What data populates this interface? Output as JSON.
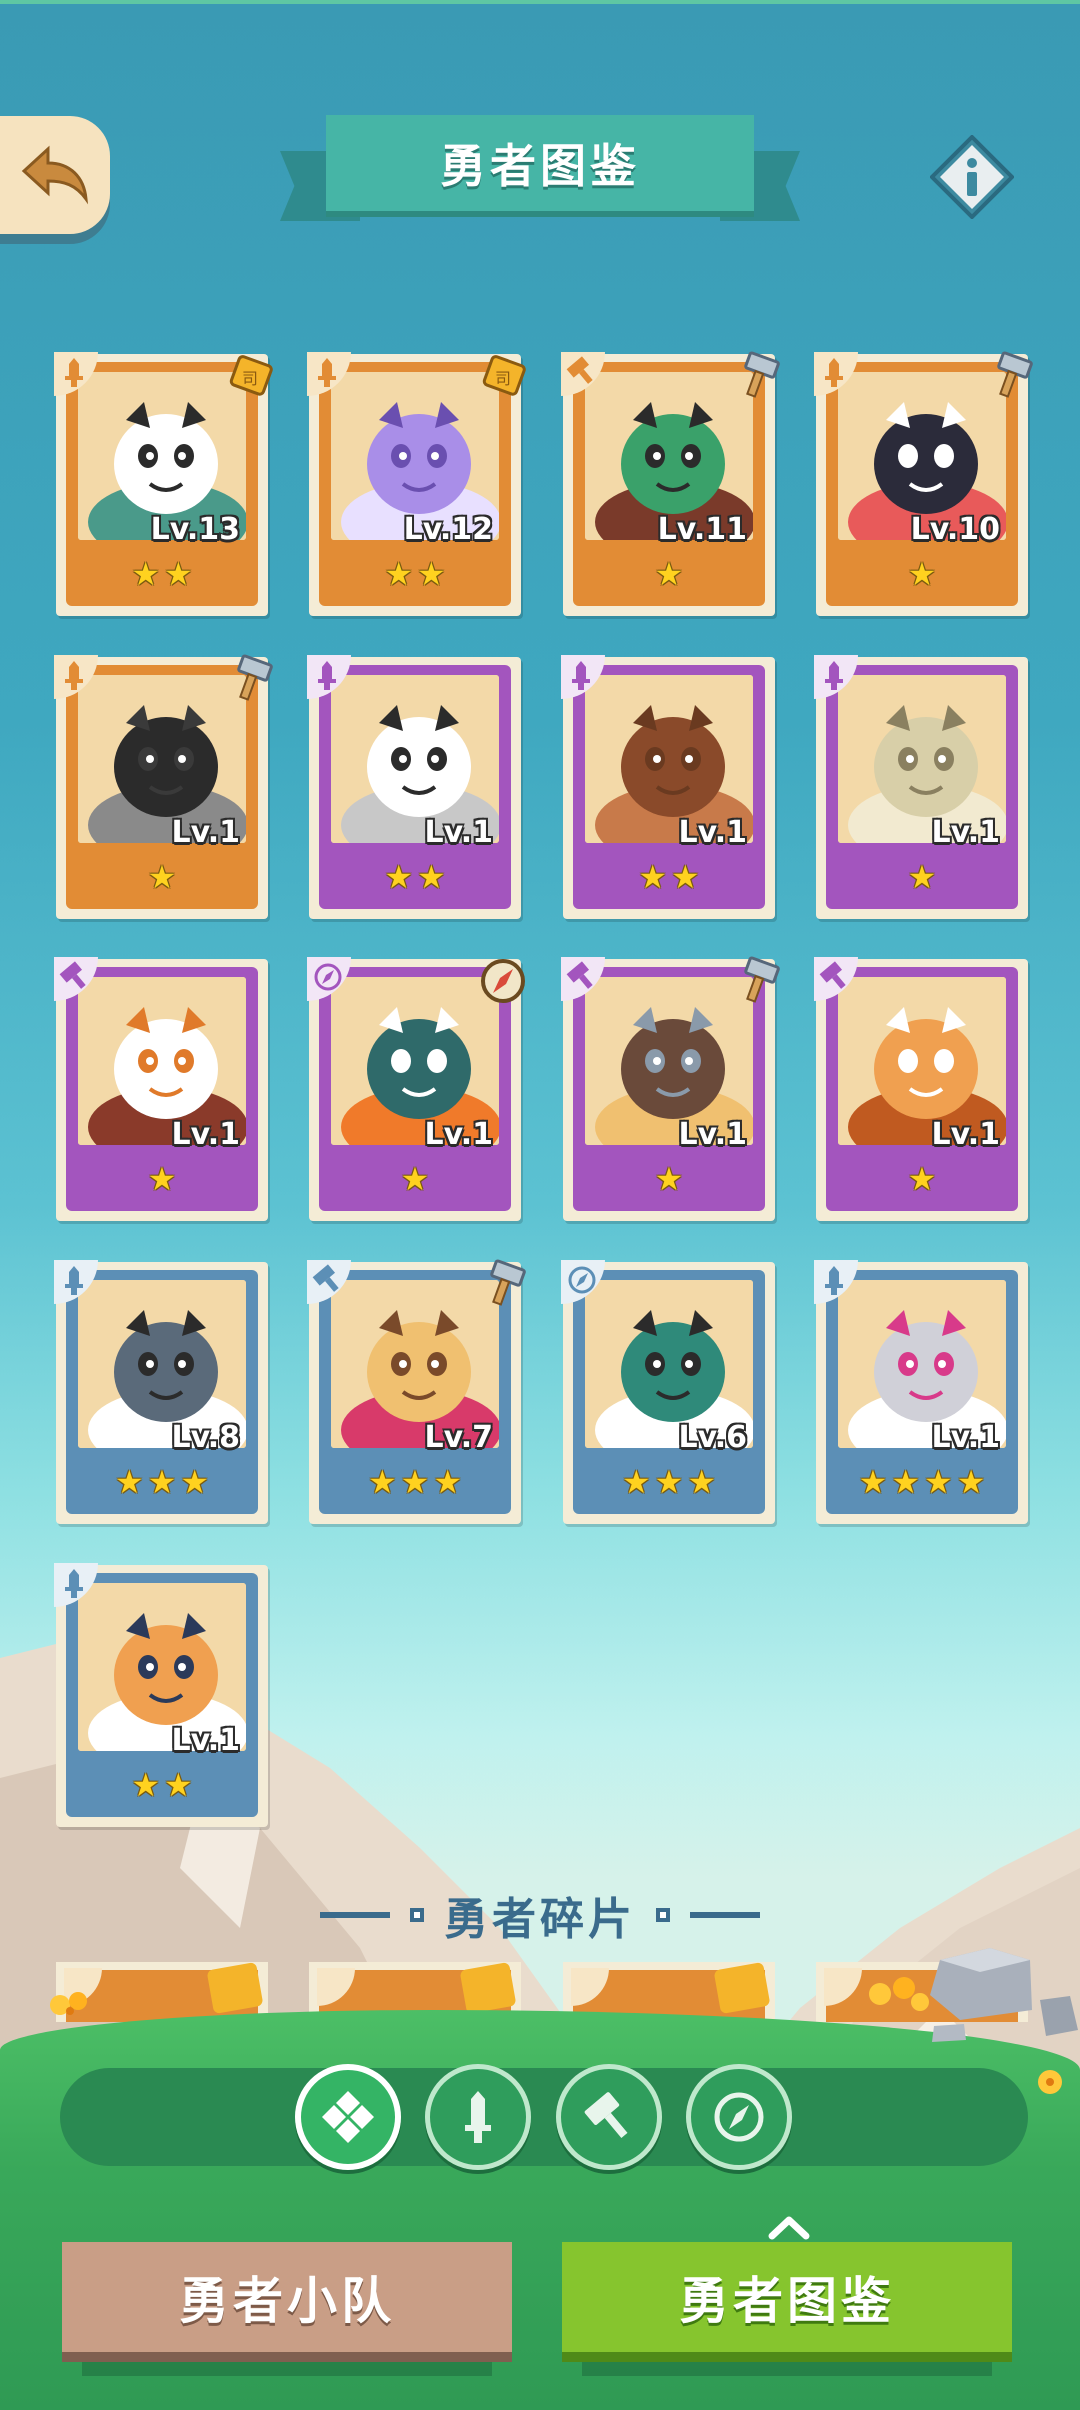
{
  "header": {
    "title": "勇者图鉴",
    "back_icon": "back-arrow-icon",
    "info_icon": "info-icon"
  },
  "heroes": [
    {
      "level": "Lv.13",
      "stars": 2,
      "frame": "orange",
      "class_icon": "sword-icon",
      "equip": "scroll-icon"
    },
    {
      "level": "Lv.12",
      "stars": 2,
      "frame": "orange",
      "class_icon": "sword-icon",
      "equip": "scroll-icon"
    },
    {
      "level": "Lv.11",
      "stars": 1,
      "frame": "orange",
      "class_icon": "hammer-icon",
      "equip": "hammer-icon"
    },
    {
      "level": "Lv.10",
      "stars": 1,
      "frame": "orange",
      "class_icon": "sword-icon",
      "equip": "hammer-icon"
    },
    {
      "level": "Lv.1",
      "stars": 1,
      "frame": "orange",
      "class_icon": "sword-icon",
      "equip": "hammer-icon"
    },
    {
      "level": "Lv.1",
      "stars": 2,
      "frame": "purple",
      "class_icon": "sword-icon",
      "equip": ""
    },
    {
      "level": "Lv.1",
      "stars": 2,
      "frame": "purple",
      "class_icon": "sword-icon",
      "equip": ""
    },
    {
      "level": "Lv.1",
      "stars": 1,
      "frame": "purple",
      "class_icon": "sword-icon",
      "equip": ""
    },
    {
      "level": "Lv.1",
      "stars": 1,
      "frame": "purple",
      "class_icon": "hammer-icon",
      "equip": ""
    },
    {
      "level": "Lv.1",
      "stars": 1,
      "frame": "purple",
      "class_icon": "compass-icon",
      "equip": "compass-icon"
    },
    {
      "level": "Lv.1",
      "stars": 1,
      "frame": "purple",
      "class_icon": "hammer-icon",
      "equip": "hammer-icon"
    },
    {
      "level": "Lv.1",
      "stars": 1,
      "frame": "purple",
      "class_icon": "hammer-icon",
      "equip": ""
    },
    {
      "level": "Lv.8",
      "stars": 3,
      "frame": "blue",
      "class_icon": "sword-icon",
      "equip": ""
    },
    {
      "level": "Lv.7",
      "stars": 3,
      "frame": "blue",
      "class_icon": "hammer-icon",
      "equip": "hammer-icon"
    },
    {
      "level": "Lv.6",
      "stars": 3,
      "frame": "blue",
      "class_icon": "compass-icon",
      "equip": ""
    },
    {
      "level": "Lv.1",
      "stars": 4,
      "frame": "blue",
      "class_icon": "sword-icon",
      "equip": ""
    },
    {
      "level": "Lv.1",
      "stars": 2,
      "frame": "blue",
      "class_icon": "sword-icon",
      "equip": ""
    }
  ],
  "fragments": {
    "title": "勇者碎片"
  },
  "filters": [
    {
      "name": "all",
      "icon": "diamond-grid-icon",
      "active": true
    },
    {
      "name": "sword",
      "icon": "sword-icon",
      "active": false
    },
    {
      "name": "hammer",
      "icon": "hammer-icon",
      "active": false
    },
    {
      "name": "compass",
      "icon": "compass-icon",
      "active": false
    }
  ],
  "tabs": {
    "team": "勇者小队",
    "dex": "勇者图鉴"
  },
  "colors": {
    "orange_frame": "#e28c35",
    "purple_frame": "#a355be",
    "blue_frame": "#5c8fb6",
    "star": "#ffd21f",
    "title_plate": "#46b5a6",
    "tab_active": "#86c52e",
    "tab_inactive": "#c99e86"
  }
}
